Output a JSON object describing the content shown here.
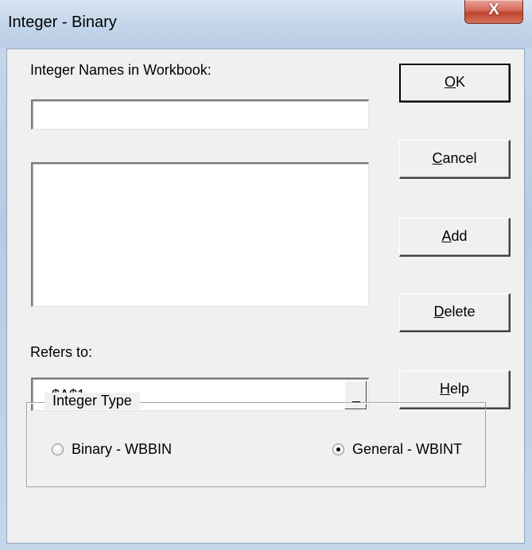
{
  "window": {
    "title": "Integer - Binary",
    "close_label": "X"
  },
  "names": {
    "label": "Integer Names in Workbook:",
    "input_value": "",
    "list_items": []
  },
  "refers": {
    "label": "Refers to:",
    "value": "$A$1"
  },
  "buttons": {
    "ok": {
      "pre": "",
      "accel": "O",
      "post": "K"
    },
    "cancel": {
      "pre": "",
      "accel": "C",
      "post": "ancel"
    },
    "add": {
      "pre": "",
      "accel": "A",
      "post": "dd"
    },
    "delete": {
      "pre": "",
      "accel": "D",
      "post": "elete"
    },
    "help": {
      "pre": "",
      "accel": "H",
      "post": "elp"
    }
  },
  "integer_type": {
    "legend": "Integer Type",
    "options": [
      {
        "label": "Binary - WBBIN",
        "selected": false
      },
      {
        "label": "General - WBINT",
        "selected": true
      }
    ]
  }
}
